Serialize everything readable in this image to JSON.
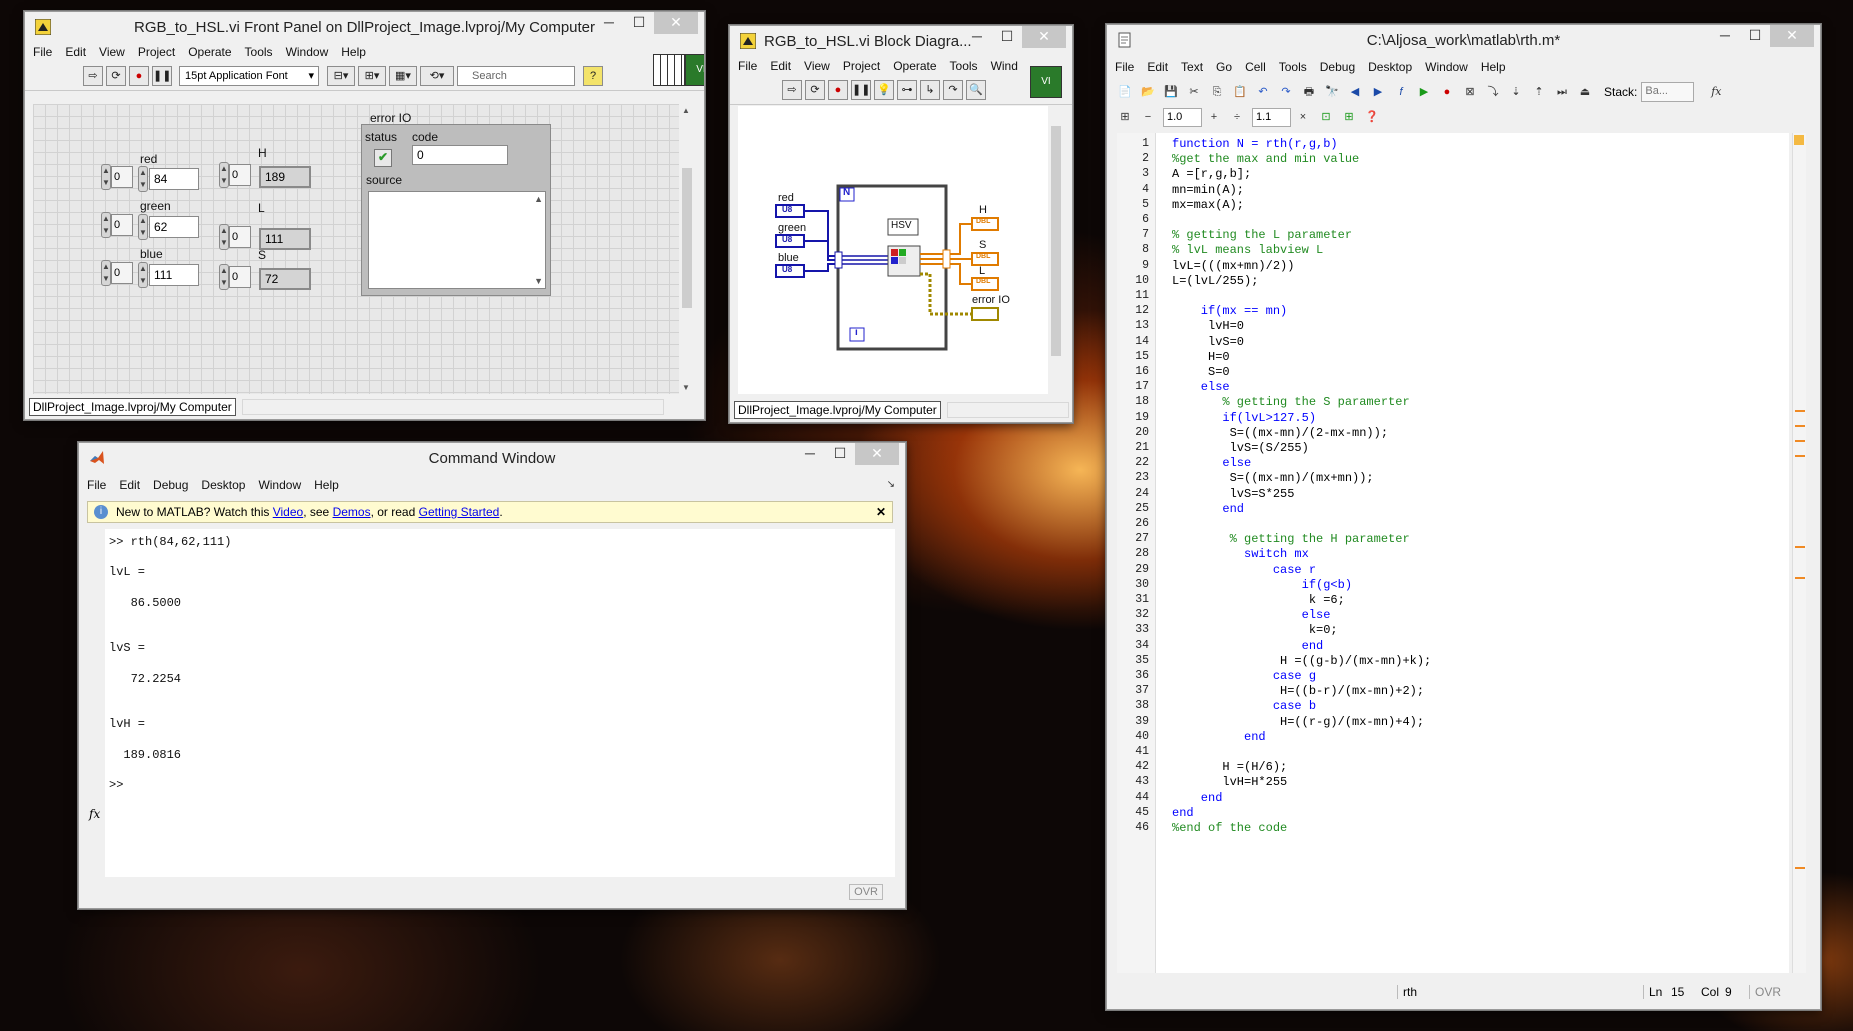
{
  "front_panel": {
    "title": "RGB_to_HSL.vi Front Panel on DllProject_Image.lvproj/My Computer",
    "menu": [
      "File",
      "Edit",
      "View",
      "Project",
      "Operate",
      "Tools",
      "Window",
      "Help"
    ],
    "font": "15pt Application Font",
    "search_placeholder": "Search",
    "controls": {
      "red_label": "red",
      "red_radix": "0",
      "red_value": "84",
      "green_label": "green",
      "green_radix": "0",
      "green_value": "62",
      "blue_label": "blue",
      "blue_radix": "0",
      "blue_value": "111"
    },
    "indicators": {
      "h_label": "H",
      "h_radix": "0",
      "h_value": "189",
      "l_label": "L",
      "l_radix": "0",
      "l_value": "111",
      "s_label": "S",
      "s_radix": "0",
      "s_value": "72"
    },
    "error_io": {
      "label": "error IO",
      "status_label": "status",
      "code_label": "code",
      "code_value": "0",
      "source_label": "source"
    },
    "path": "DllProject_Image.lvproj/My Computer"
  },
  "block_diagram": {
    "title": "RGB_to_HSL.vi Block Diagra...",
    "menu": [
      "File",
      "Edit",
      "View",
      "Project",
      "Operate",
      "Tools",
      "Wind"
    ],
    "red": "red",
    "green": "green",
    "blue": "blue",
    "u8": "U8",
    "n": "N",
    "i": "i",
    "hsv": "HSV",
    "h": "H",
    "s": "S",
    "l": "L",
    "dbl": "DBL",
    "error_io": "error IO",
    "path": "DllProject_Image.lvproj/My Computer"
  },
  "command_window": {
    "title": "Command Window",
    "menu": [
      "File",
      "Edit",
      "Debug",
      "Desktop",
      "Window",
      "Help"
    ],
    "info_pre": "New to MATLAB? Watch this ",
    "info_video": "Video",
    "info_mid1": ", see ",
    "info_demos": "Demos",
    "info_mid2": ", or read ",
    "info_getting_started": "Getting Started",
    "info_end": ".",
    "lines": [
      ">> rth(84,62,111)",
      "lvL =",
      "   86.5000",
      "lvS =",
      "   72.2254",
      "lvH =",
      "  189.0816",
      ">>"
    ],
    "ovr": "OVR"
  },
  "editor": {
    "title": "C:\\Aljosa_work\\matlab\\rth.m*",
    "menu": [
      "File",
      "Edit",
      "Text",
      "Go",
      "Cell",
      "Tools",
      "Debug",
      "Desktop",
      "Window",
      "Help"
    ],
    "stack_label": "Stack:",
    "stack_value": "Ba...",
    "cell_step1": "1.0",
    "cell_step2": "1.1",
    "code": [
      {
        "n": "1",
        "t": "function N = rth(r,g,b)"
      },
      {
        "n": "2",
        "t": "%get the max and min value"
      },
      {
        "n": "3",
        "t": "A =[r,g,b];"
      },
      {
        "n": "4",
        "t": "mn=min(A);"
      },
      {
        "n": "5",
        "t": "mx=max(A);"
      },
      {
        "n": "6",
        "t": ""
      },
      {
        "n": "7",
        "t": "% getting the L parameter"
      },
      {
        "n": "8",
        "t": "% lvL means labview L"
      },
      {
        "n": "9",
        "t": "lvL=(((mx+mn)/2))"
      },
      {
        "n": "10",
        "t": "L=(lvL/255);"
      },
      {
        "n": "11",
        "t": ""
      },
      {
        "n": "12",
        "t": "    if(mx == mn)"
      },
      {
        "n": "13",
        "t": "     lvH=0"
      },
      {
        "n": "14",
        "t": "     lvS=0"
      },
      {
        "n": "15",
        "t": "     H=0"
      },
      {
        "n": "16",
        "t": "     S=0"
      },
      {
        "n": "17",
        "t": "    else"
      },
      {
        "n": "18",
        "t": "       % getting the S paramerter"
      },
      {
        "n": "19",
        "t": "       if(lvL>127.5)"
      },
      {
        "n": "20",
        "t": "        S=((mx-mn)/(2-mx-mn));"
      },
      {
        "n": "21",
        "t": "        lvS=(S/255)"
      },
      {
        "n": "22",
        "t": "       else"
      },
      {
        "n": "23",
        "t": "        S=((mx-mn)/(mx+mn));"
      },
      {
        "n": "24",
        "t": "        lvS=S*255"
      },
      {
        "n": "25",
        "t": "       end"
      },
      {
        "n": "26",
        "t": ""
      },
      {
        "n": "27",
        "t": "        % getting the H parameter"
      },
      {
        "n": "28",
        "t": "          switch mx"
      },
      {
        "n": "29",
        "t": "              case r"
      },
      {
        "n": "30",
        "t": "                  if(g<b)"
      },
      {
        "n": "31",
        "t": "                   k =6;"
      },
      {
        "n": "32",
        "t": "                  else"
      },
      {
        "n": "33",
        "t": "                   k=0;"
      },
      {
        "n": "34",
        "t": "                  end"
      },
      {
        "n": "35",
        "t": "               H =((g-b)/(mx-mn)+k);"
      },
      {
        "n": "36",
        "t": "              case g"
      },
      {
        "n": "37",
        "t": "               H=((b-r)/(mx-mn)+2);"
      },
      {
        "n": "38",
        "t": "              case b"
      },
      {
        "n": "39",
        "t": "               H=((r-g)/(mx-mn)+4);"
      },
      {
        "n": "40",
        "t": "          end"
      },
      {
        "n": "41",
        "t": ""
      },
      {
        "n": "42",
        "t": "       H =(H/6);"
      },
      {
        "n": "43",
        "t": "       lvH=H*255"
      },
      {
        "n": "44",
        "t": "    end"
      },
      {
        "n": "45",
        "t": "end"
      },
      {
        "n": "46",
        "t": "%end of the code"
      }
    ],
    "status_name": "rth",
    "ln_label": "Ln",
    "ln_value": "15",
    "col_label": "Col",
    "col_value": "9",
    "ovr": "OVR"
  }
}
